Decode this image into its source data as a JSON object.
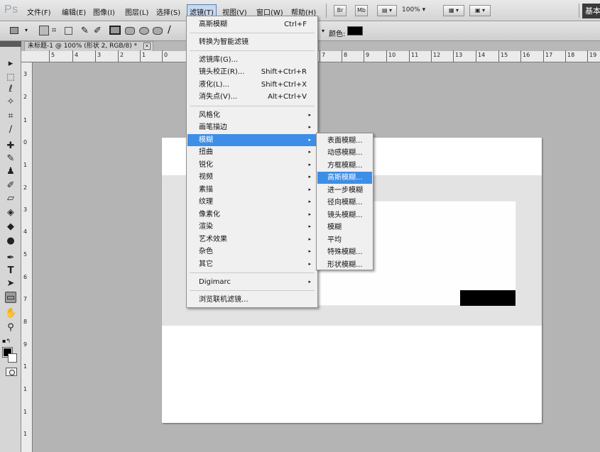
{
  "app": {
    "logo": "Ps"
  },
  "menubar": {
    "items": [
      "文件(F)",
      "编辑(E)",
      "图像(I)",
      "图层(L)",
      "选择(S)",
      "滤镜(T)",
      "视图(V)",
      "窗口(W)",
      "帮助(H)"
    ],
    "bridge_label": "Br",
    "minibridge_label": "Mb",
    "zoom": "100%",
    "workspace_label": "基本"
  },
  "options": {
    "color_label": "颜色:",
    "color_value": "#000000"
  },
  "document": {
    "tab_title": "未标题-1 @ 100% (形状 2, RGB/8) *",
    "close_glyph": "×"
  },
  "ruler": {
    "h_labels": [
      "5",
      "4",
      "3",
      "2",
      "1",
      "0",
      "7",
      "8",
      "9",
      "10",
      "11",
      "12",
      "13",
      "14",
      "15",
      "16",
      "17",
      "18",
      "19"
    ],
    "v_labels": [
      "3",
      "2",
      "1",
      "0",
      "1",
      "2",
      "3",
      "4",
      "5",
      "6",
      "7",
      "8",
      "9",
      "1",
      "1",
      "1",
      "1"
    ]
  },
  "filter_menu": {
    "last_filter": "高斯模糊",
    "last_filter_shortcut": "Ctrl+F",
    "convert_smart": "转换为智能滤镜",
    "gallery": "滤镜库(G)...",
    "lens_correction": "镜头校正(R)...",
    "lens_correction_shortcut": "Shift+Ctrl+R",
    "liquify": "液化(L)...",
    "liquify_shortcut": "Shift+Ctrl+X",
    "vanishing_point": "消失点(V)...",
    "vanishing_point_shortcut": "Alt+Ctrl+V",
    "submenus": [
      "风格化",
      "画笔描边",
      "模糊",
      "扭曲",
      "锐化",
      "视频",
      "素描",
      "纹理",
      "像素化",
      "渲染",
      "艺术效果",
      "杂色",
      "其它"
    ],
    "digimarc": "Digimarc",
    "browse_online": "浏览联机滤镜...",
    "arrow_glyph": "▸"
  },
  "blur_submenu": {
    "items": [
      "表面模糊...",
      "动感模糊...",
      "方框模糊...",
      "高斯模糊...",
      "进一步模糊",
      "径向模糊...",
      "镜头模糊...",
      "模糊",
      "平均",
      "特殊模糊...",
      "形状模糊..."
    ]
  },
  "colors": {
    "menu_highlight": "#3d8ee6",
    "foreground": "#000000",
    "background": "#ffffff"
  }
}
